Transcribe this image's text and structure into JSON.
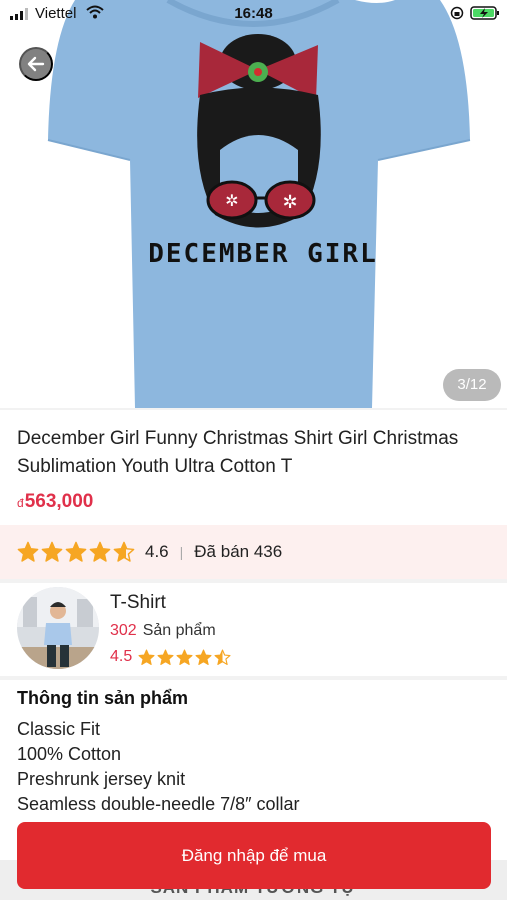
{
  "status_bar": {
    "carrier": "Viettel",
    "time": "16:48"
  },
  "gallery": {
    "counter": "3/12",
    "shirt_print_text": "DECEMBER GIRL",
    "shirt_color": "#8db7de"
  },
  "product": {
    "title": "December Girl Funny Christmas Shirt Girl Christmas Sublimation Youth Ultra Cotton T",
    "currency_symbol": "đ",
    "price": "563,000",
    "rating": "4.6",
    "rating_value": 4.6,
    "sold_label": "Đã bán 436"
  },
  "shop": {
    "name": "T-Shirt",
    "product_count": "302",
    "product_label": "Sản phẩm",
    "rating": "4.5",
    "rating_value": 4.5
  },
  "info": {
    "heading": "Thông tin sản phẩm",
    "lines": [
      "Classic Fit",
      "100% Cotton",
      "Preshrunk jersey knit",
      "Seamless double-needle 7/8″ collar"
    ]
  },
  "similar": {
    "label": "❛ SẢN PHẨM TƯƠNG TỰ ❜"
  },
  "buy_button": {
    "label": "Đăng nhập để mua"
  },
  "colors": {
    "accent": "#e12a2f",
    "price": "#e0304a",
    "star": "#f6a623",
    "rating_bg": "#fdf0ef"
  }
}
